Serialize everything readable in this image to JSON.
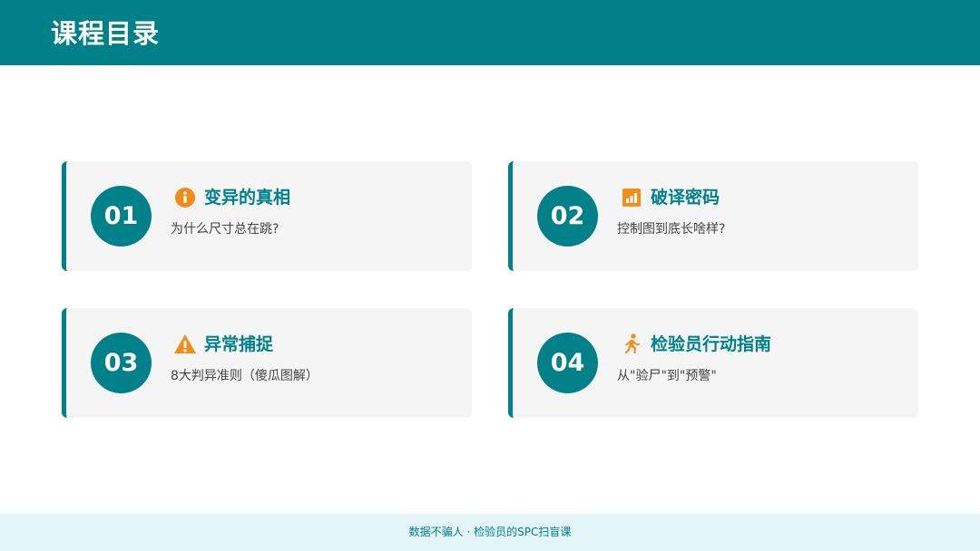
{
  "header": {
    "title": "课程目录"
  },
  "colors": {
    "accent": "#00818a",
    "icon_orange": "#f28c1a",
    "card_bg": "#f5f5f5",
    "footer_bg": "#e3f5f7"
  },
  "cards": [
    {
      "number": "01",
      "icon": "info-icon",
      "title": "变异的真相",
      "subtitle": "为什么尺寸总在跳?"
    },
    {
      "number": "02",
      "icon": "bar-chart-icon",
      "title": "破译密码",
      "subtitle": "控制图到底长啥样?"
    },
    {
      "number": "03",
      "icon": "warning-icon",
      "title": "异常捕捉",
      "subtitle": "8大判异准则（傻瓜图解）"
    },
    {
      "number": "04",
      "icon": "running-person-icon",
      "title": "检验员行动指南",
      "subtitle": "从\"验尸\"到\"预警\""
    }
  ],
  "footer": {
    "text": "数据不骗人 · 检验员的SPC扫盲课"
  }
}
